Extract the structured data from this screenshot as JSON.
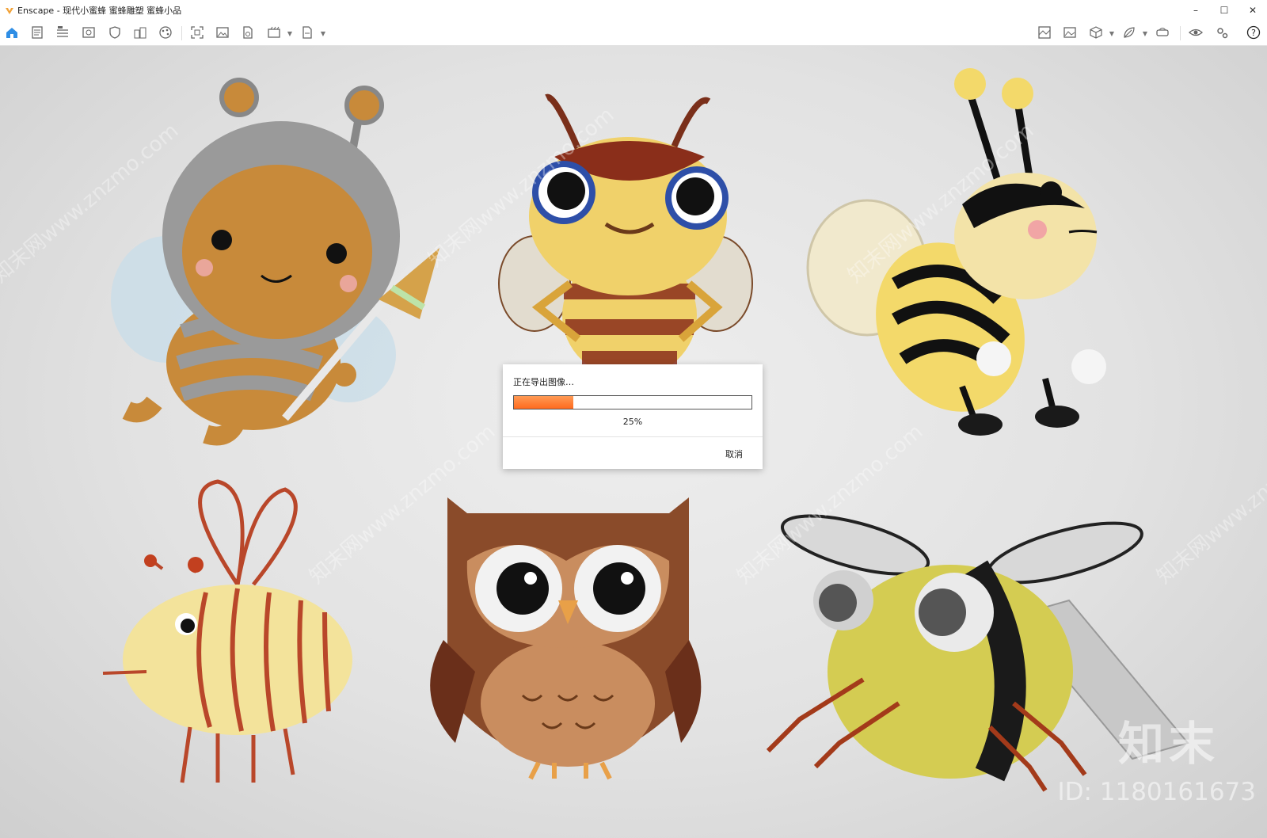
{
  "window": {
    "app_name": "Enscape",
    "title": "Enscape - 现代小蜜蜂 蜜蜂雕塑 蜜蜂小品",
    "controls": [
      "–",
      "☐",
      "✕"
    ]
  },
  "toolbar": {
    "left_icons": [
      "home-icon",
      "document-icon",
      "bim-list-icon",
      "view-icon",
      "shield-icon",
      "buildings-icon",
      "palette-icon",
      "capture-region-icon",
      "image-icon",
      "file-export-icon",
      "batch-render-icon",
      "export-dropdown-icon"
    ],
    "right_icons": [
      "asset-library-icon",
      "gallery-icon",
      "cube-icon",
      "leaf-icon",
      "vr-headset-icon",
      "eye-icon",
      "settings-icon",
      "help-icon"
    ],
    "collapse_glyph": "^"
  },
  "dialog": {
    "message": "正在导出图像…",
    "progress": 0.25,
    "progress_label": "25%",
    "cancel_label": "取消",
    "accent_color": "#ff7a2e"
  },
  "watermark": {
    "brand": "知末",
    "id_text": "ID: 1180161673"
  }
}
